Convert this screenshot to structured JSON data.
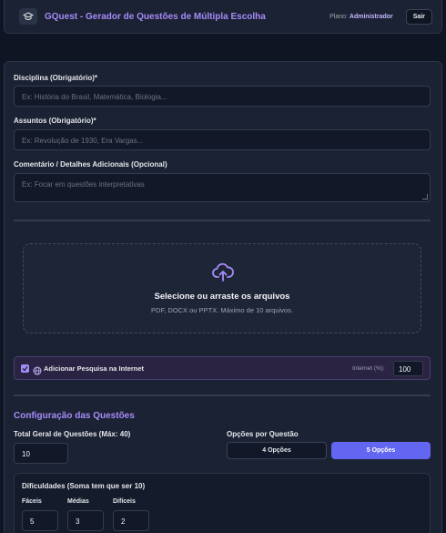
{
  "header": {
    "title": "GQuest - Gerador de Questões de Múltipla Escolha",
    "plan_label": "Plano:",
    "plan_value": "Administrador",
    "logout_label": "Sair"
  },
  "form": {
    "discipline": {
      "label": "Disciplina (Obrigatório)*",
      "placeholder": "Ex: História do Brasil, Matemática, Biologia..."
    },
    "subjects": {
      "label": "Assuntos (Obrigatório)*",
      "placeholder": "Ex: Revolução de 1930, Era Vargas..."
    },
    "comment": {
      "label": "Comentário / Detalhes Adicionais (Opcional)",
      "placeholder": "Ex: Focar em questões interpretativas"
    }
  },
  "upload": {
    "title": "Selecione ou arraste os arquivos",
    "subtitle": "PDF, DOCX ou PPTX. Máximo de 10 arquivos."
  },
  "internet": {
    "label": "Adicionar Pesquisa na Internet",
    "checked": true,
    "percent_label": "Internet (%):",
    "percent_value": "100"
  },
  "config": {
    "title": "Configuração das Questões",
    "total_label": "Total Geral de Questões (Máx: 40)",
    "total_value": "10",
    "options_label": "Opções por Questão",
    "option_4": "4 Opções",
    "option_5": "5 Opções",
    "selected_option": "5 Opções"
  },
  "difficulty": {
    "title": "Dificuldades (Soma tem que ser 10)",
    "easy_label": "Fáceis",
    "easy_value": "5",
    "medium_label": "Médias",
    "medium_value": "3",
    "hard_label": "Difíceis",
    "hard_value": "2"
  },
  "colors": {
    "accent": "#a78bfa",
    "primary_button": "#6366f1",
    "background": "#0f1523",
    "card": "#1b2233"
  }
}
